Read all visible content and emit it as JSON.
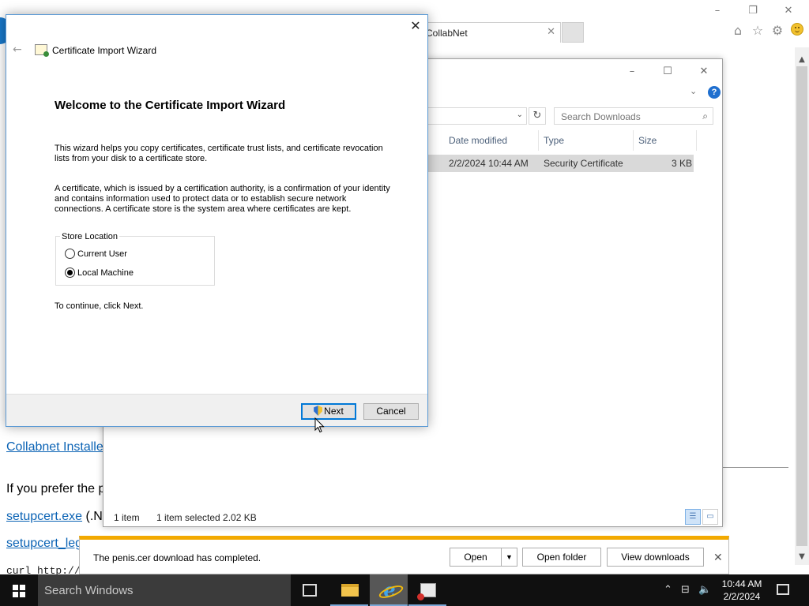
{
  "browser": {
    "tab_title": "CollabNet",
    "page": {
      "link_installer": "Collabnet Installe",
      "prefer_text": "If you prefer the p",
      "link_setupcert": "setupcert.exe",
      "setupcert_suffix": "(.N",
      "link_setupcert_leg": "setupcert_leg",
      "curl_text": "curl http://"
    }
  },
  "explorer": {
    "search_placeholder": "Search Downloads",
    "columns": [
      "Date modified",
      "Type",
      "Size"
    ],
    "files": [
      {
        "date_modified": "2/2/2024 10:44 AM",
        "type": "Security Certificate",
        "size": "3 KB"
      }
    ],
    "status": {
      "item_count": "1 item",
      "selection": "1 item selected  2.02 KB"
    }
  },
  "wizard": {
    "window_title": "Certificate Import Wizard",
    "heading": "Welcome to the Certificate Import Wizard",
    "para1_line1": "This wizard helps you copy certificates, certificate trust lists, and certificate revocation",
    "para1_line2": "lists from your disk to a certificate store.",
    "para2_line1": "A certificate, which is issued by a certification authority, is a confirmation of your identity",
    "para2_line2": "and contains information used to protect data or to establish secure network",
    "para2_line3": "connections. A certificate store is the system area where certificates are kept.",
    "store_location_label": "Store Location",
    "options": [
      {
        "label": "Current User",
        "selected": false
      },
      {
        "label": "Local Machine",
        "selected": true
      }
    ],
    "continue_text": "To continue, click Next.",
    "next_label": "Next",
    "cancel_label": "Cancel"
  },
  "download_bar": {
    "message": "The penis.cer download has completed.",
    "open_label": "Open",
    "open_folder_label": "Open folder",
    "view_downloads_label": "View downloads"
  },
  "taskbar": {
    "search_placeholder": "Search Windows",
    "clock_time": "10:44 AM",
    "clock_date": "2/2/2024"
  },
  "colors": {
    "accent": "#0078d7",
    "download_bar_accent": "#f2a900",
    "taskbar": "#101010",
    "link": "#0b63b5"
  }
}
